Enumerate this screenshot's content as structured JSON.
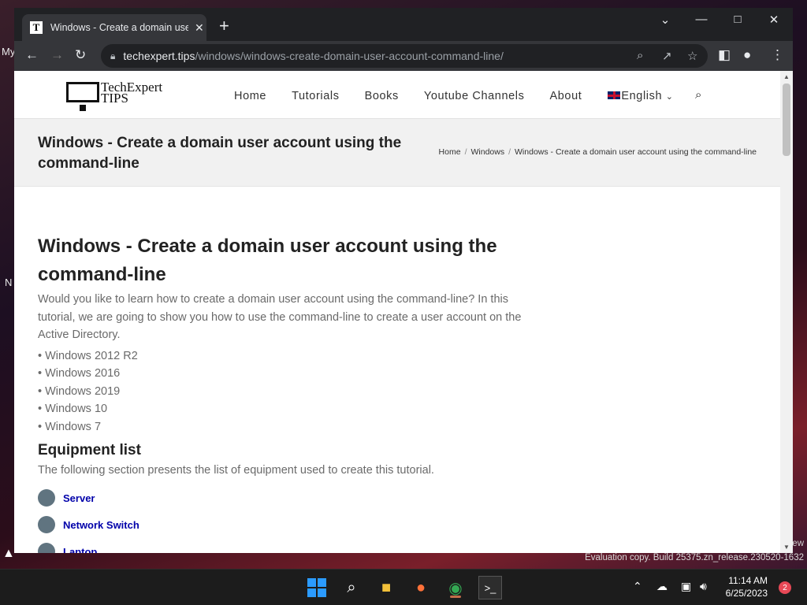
{
  "desktop": {
    "left_text_1": "My",
    "left_text_2": "N",
    "eval_suffix": "ew",
    "eval_text": "Evaluation copy. Build 25375.zn_release.230520-1632"
  },
  "browser": {
    "tab_title": "Windows - Create a domain user account using the command-line",
    "tab_icon_letter": "T",
    "url_host": "techexpert.tips",
    "url_path": "/windows/windows-create-domain-user-account-command-line/"
  },
  "site": {
    "logo_line1": "TechExpert",
    "logo_line2": "TIPS",
    "menu": [
      "Home",
      "Tutorials",
      "Books",
      "Youtube Channels",
      "About"
    ],
    "language": "English",
    "banner_title": "Windows - Create a domain user account using the command-line",
    "breadcrumbs": [
      "Home",
      "Windows",
      "Windows - Create a domain user account using the command-line"
    ]
  },
  "article": {
    "title": "Windows - Create a domain user account using the command-line",
    "intro": "Would you like to learn how to create a domain user account using the command-line? In this tutorial, we are going to show you how to use the command-line to create a user account on the Active Directory.",
    "os_list": [
      "• Windows 2012 R2",
      "• Windows 2016",
      "• Windows 2019",
      "• Windows 10",
      "• Windows 7"
    ],
    "equipment_heading": "Equipment list",
    "equipment_intro": "The following section presents the list of equipment used to create this tutorial.",
    "equipment": [
      "Server",
      "Network Switch",
      "Laptop"
    ]
  },
  "taskbar": {
    "time": "11:14 AM",
    "date": "6/25/2023",
    "notifications": "2"
  },
  "colors": {
    "link": "#0000aa",
    "equipment_dot": "#607480",
    "chrome_dark": "#202124"
  }
}
